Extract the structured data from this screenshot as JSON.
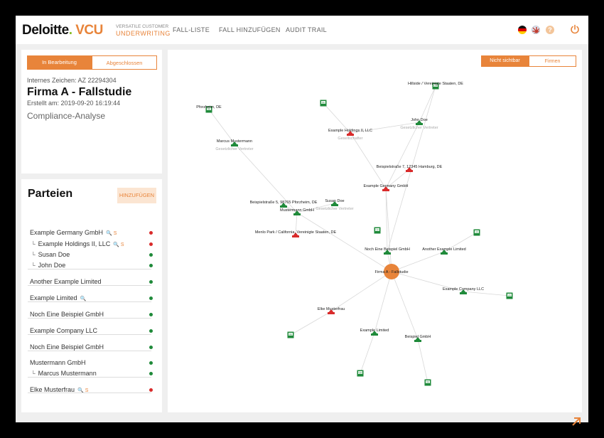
{
  "header": {
    "logo_main": "Deloitte",
    "logo_dot": ".",
    "logo_brand": "VCU",
    "logo_sub1": "VERSATILE CUSTOMER",
    "logo_sub2": "UNDERWRITING",
    "nav": [
      "FALL-LISTE",
      "FALL HINZUFÜGEN",
      "AUDIT TRAIL"
    ],
    "help": "?"
  },
  "case": {
    "tabs": [
      "In Bearbeitung",
      "Abgeschlossen"
    ],
    "ref": "Internes Zeichen: AZ 22294304",
    "title": "Firma A - Fallstudie",
    "created": "Erstellt am: 2019-09-20 16:19:44",
    "type": "Compliance-Analyse"
  },
  "parties": {
    "title": "Parteien",
    "add_label": "HINZUFÜGEN",
    "items": [
      {
        "label": "Example Germany GmbH",
        "icons": "🔍 S",
        "status": "red"
      },
      {
        "label": "Example Holdings II, LLC",
        "icons": "🔍 S",
        "status": "red",
        "child": true
      },
      {
        "label": "Susan Doe",
        "icons": "",
        "status": "green",
        "child": true
      },
      {
        "label": "John Doe",
        "icons": "",
        "status": "green",
        "child": true
      },
      {
        "label": "Another Example Limited",
        "icons": "",
        "status": "green"
      },
      {
        "label": "Example Limited",
        "icons": "🔍",
        "status": "green"
      },
      {
        "label": "Noch Eine Beispiel GmbH",
        "icons": "",
        "status": "green"
      },
      {
        "label": "Example Company LLC",
        "icons": "",
        "status": "green"
      },
      {
        "label": "Noch Eine Beispiel GmbH",
        "icons": "",
        "status": "green"
      },
      {
        "label": "Mustermann GmbH",
        "icons": "",
        "status": "green"
      },
      {
        "label": "Marcus Mustermann",
        "icons": "",
        "status": "green",
        "child": true
      },
      {
        "label": "Elke Musterfrau",
        "icons": "🔍 S",
        "status": "red"
      }
    ]
  },
  "graph": {
    "toggle": [
      "Nicht sichtbar",
      "Firmen"
    ],
    "center": "Firma A - Fallstudie",
    "nodes": [
      {
        "label": "Hillside / Vereinigte Staaten, DE",
        "sub": "",
        "flag": "US",
        "color": "green"
      },
      {
        "label": "",
        "sub": "",
        "flag": "DE",
        "color": "green"
      },
      {
        "label": "Pforzheim, DE",
        "sub": "",
        "flag": "DE",
        "color": "green"
      },
      {
        "label": "John Doe",
        "sub": "Gesetzlicher Vertreter",
        "flag": "",
        "color": "green"
      },
      {
        "label": "Example Holdings II, LLC",
        "sub": "Gesellschafter",
        "flag": "",
        "color": "red"
      },
      {
        "label": "Marcus Mustermann",
        "sub": "Gesetzlicher Vertreter",
        "flag": "",
        "color": "green"
      },
      {
        "label": "Beispielstraße 7, 12345 Hamburg, DE",
        "sub": "",
        "flag": "",
        "color": "red"
      },
      {
        "label": "Example Germany GmbH",
        "sub": "",
        "flag": "",
        "color": "red"
      },
      {
        "label": "Beispielstraße 5, 98765 Pforzheim, DE",
        "sub": "",
        "flag": "",
        "color": "green"
      },
      {
        "label": "Susan Doe",
        "sub": "Gesetzlicher Vertreter",
        "flag": "",
        "color": "green"
      },
      {
        "label": "Mustermann GmbH",
        "sub": "",
        "flag": "",
        "color": "green"
      },
      {
        "label": "Menlo Park / California, Vereinigte Staaten, DE",
        "sub": "",
        "flag": "",
        "color": "red"
      },
      {
        "label": "",
        "sub": "",
        "flag": "CH",
        "color": "green"
      },
      {
        "label": "",
        "sub": "",
        "flag": "US",
        "color": "green"
      },
      {
        "label": "Noch Eine Beispiel GmbH",
        "sub": "",
        "flag": "",
        "color": "green"
      },
      {
        "label": "Another Example Limited",
        "sub": "",
        "flag": "",
        "color": "green"
      },
      {
        "label": "Example Company LLC",
        "sub": "",
        "flag": "",
        "color": "green"
      },
      {
        "label": "",
        "sub": "",
        "flag": "US",
        "color": "green"
      },
      {
        "label": "Elke Musterfrau",
        "sub": "",
        "flag": "",
        "color": "red"
      },
      {
        "label": "",
        "sub": "",
        "flag": "DE",
        "color": "green"
      },
      {
        "label": "Example Limited",
        "sub": "",
        "flag": "",
        "color": "green"
      },
      {
        "label": "Beispiel GmbH",
        "sub": "",
        "flag": "",
        "color": "green"
      },
      {
        "label": "",
        "sub": "",
        "flag": "GB",
        "color": "green"
      },
      {
        "label": "",
        "sub": "",
        "flag": "DE",
        "color": "green"
      }
    ]
  },
  "colors": {
    "accent": "#e8843a",
    "green": "#1f8a3a",
    "red": "#d92b2b"
  }
}
